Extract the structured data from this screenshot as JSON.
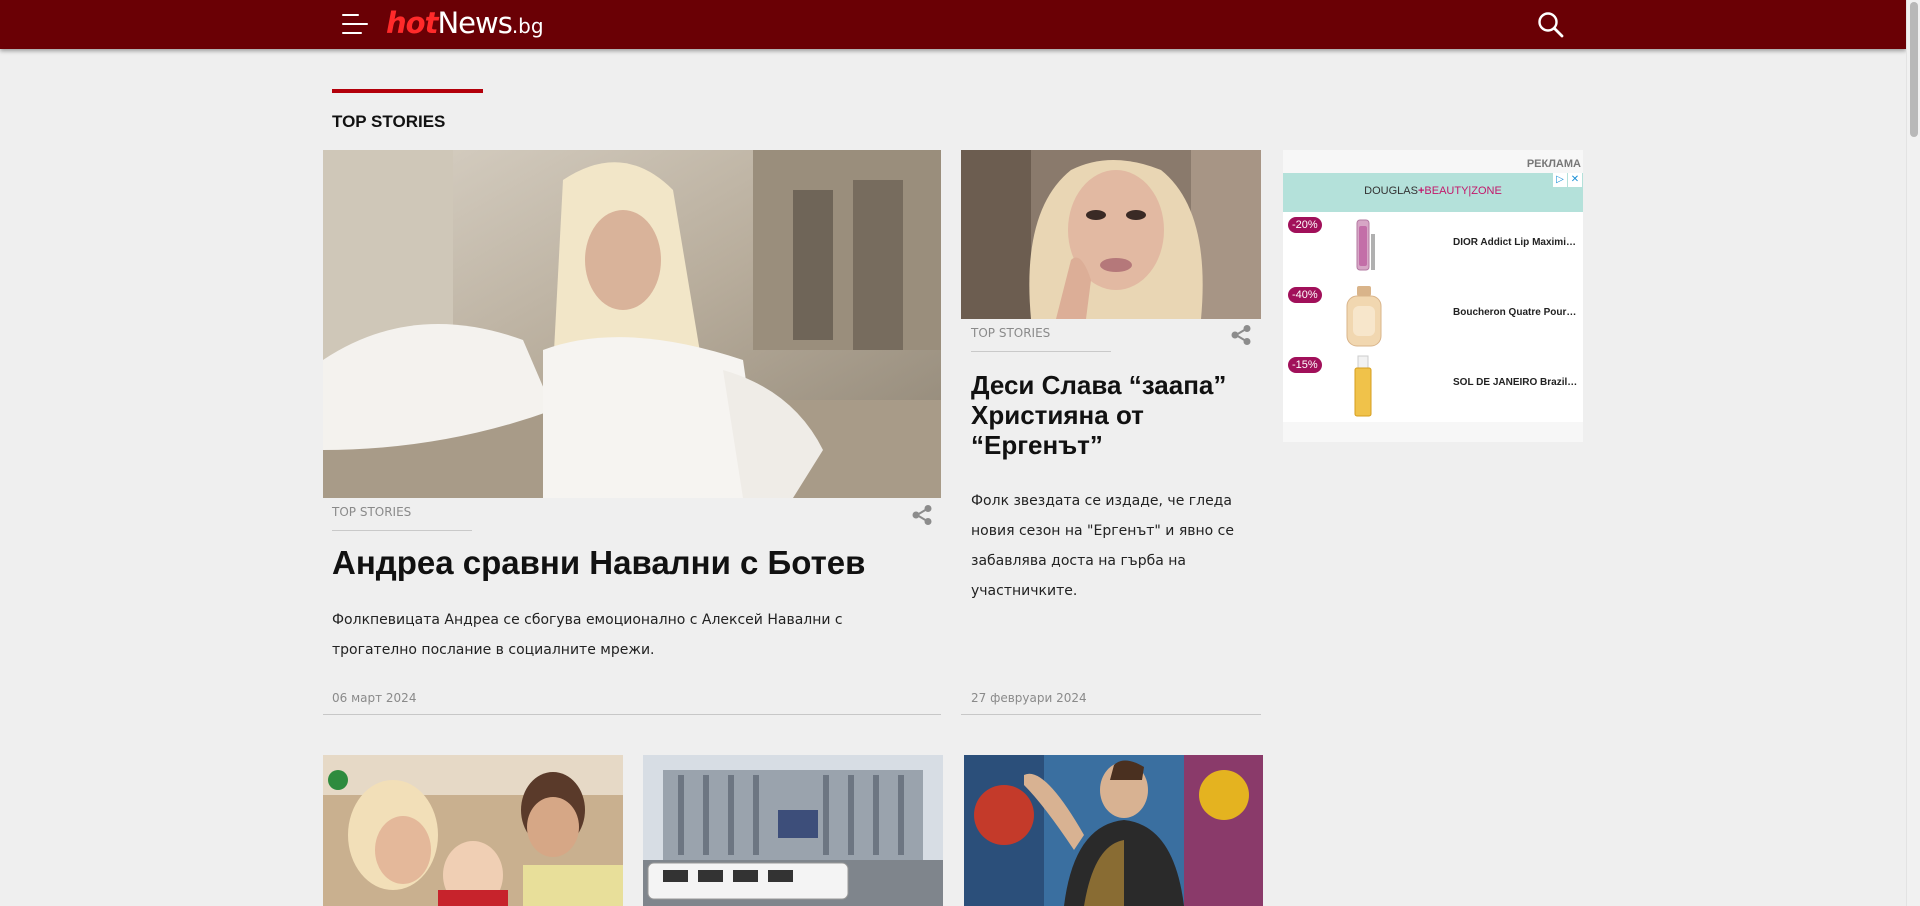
{
  "header": {
    "logo_hot": "hot",
    "logo_news": "News",
    "logo_bg": ".bg",
    "brand_color": "#6a0005",
    "accent_color": "#ff2a2a"
  },
  "section": {
    "title": "TOP STORIES"
  },
  "featured": [
    {
      "category": "TOP STORIES",
      "title": "Андреа сравни Навални с Ботев",
      "summary": "Фолкпевицата Андреа се сбогува емоционално с Алексей Навални с трогателно послание в социалните мрежи.",
      "date": "06 март 2024"
    },
    {
      "category": "TOP STORIES",
      "title": "Деси Слава “заапа” Християна от “Ергенът”",
      "summary": "Фолк звездата се издаде, че гледа новия сезон на \"Ергенът\" и явно се забавлява доста на гърба на участничките.",
      "date": "27 февруари 2024"
    }
  ],
  "ad": {
    "label": "РЕКЛАМА",
    "brand_left": "DOUGLAS",
    "brand_sep": "+",
    "brand_right": "BEAUTY|ZONE",
    "adchoice_icon": "▷",
    "close_icon": "✕",
    "products": [
      {
        "discount": "-20%",
        "name": "DIOR Addict Lip Maximizer"
      },
      {
        "discount": "-40%",
        "name": "Boucheron Quatre Pour Femme"
      },
      {
        "discount": "-15%",
        "name": "SOL DE JANEIRO Brazilian"
      }
    ]
  },
  "icons": {
    "menu": "hamburger-menu-icon",
    "search": "search-icon",
    "share": "share-icon"
  }
}
